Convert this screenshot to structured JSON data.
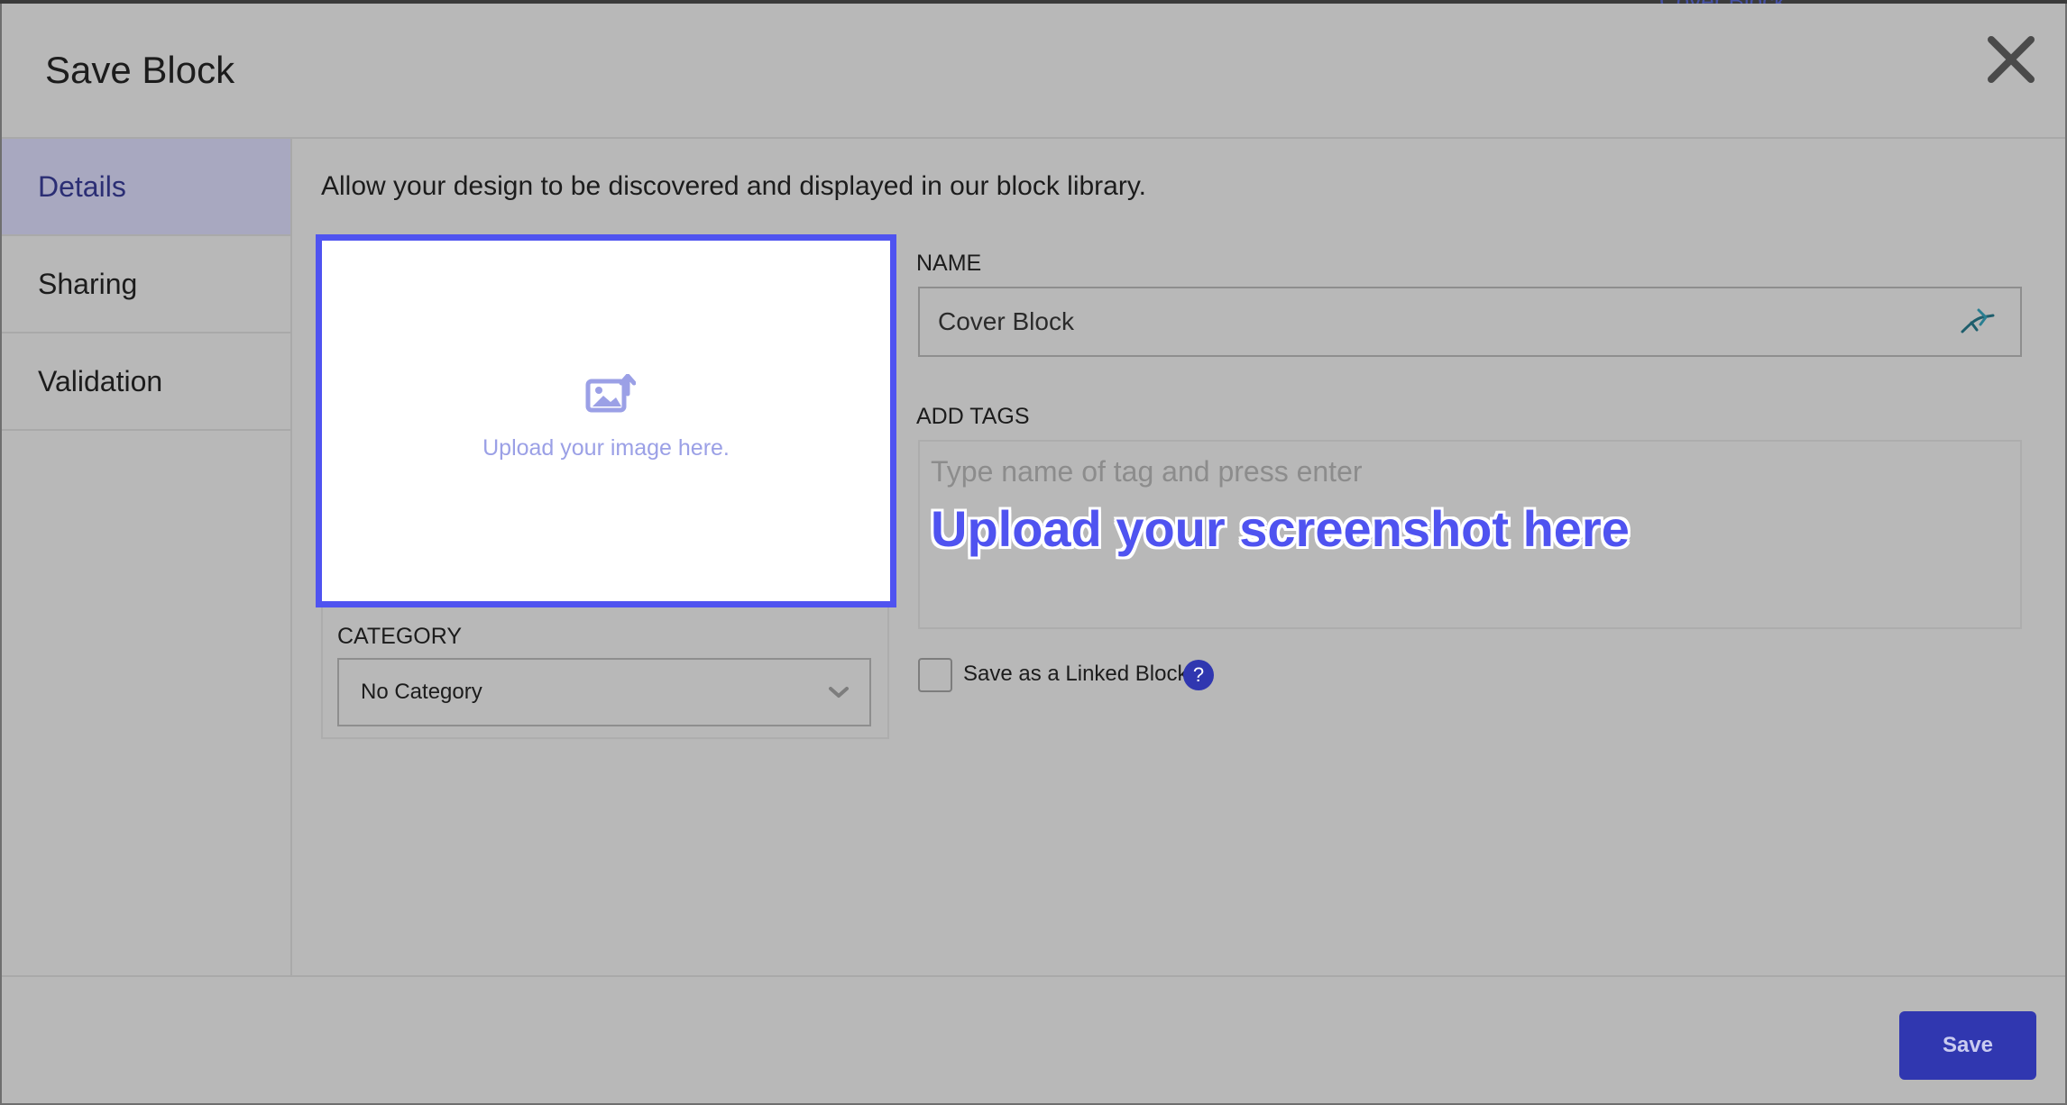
{
  "backdrop": {
    "link_text": "Cover Block"
  },
  "modal": {
    "title": "Save Block",
    "close_icon": "close-icon"
  },
  "sidebar": {
    "items": [
      {
        "label": "Details",
        "active": true
      },
      {
        "label": "Sharing",
        "active": false
      },
      {
        "label": "Validation",
        "active": false
      }
    ]
  },
  "details": {
    "intro": "Allow your design to be discovered and displayed in our block library.",
    "upload": {
      "text": "Upload your image here.",
      "icon": "image-upload-icon"
    },
    "category": {
      "label": "CATEGORY",
      "selected": "No Category",
      "icon": "chevron-down-icon"
    },
    "name": {
      "label": "NAME",
      "value": "Cover Block",
      "icon": "extension-icon"
    },
    "tags": {
      "label": "ADD TAGS",
      "placeholder": "Type name of tag and press enter"
    },
    "overlay_caption": "Upload your screenshot here",
    "linked_block": {
      "label": "Save as a Linked Block",
      "checked": false,
      "help_glyph": "?"
    }
  },
  "footer": {
    "save_label": "Save"
  },
  "colors": {
    "accent": "#4f53f0",
    "primary_button": "#3037b0",
    "active_tab_text": "#2b2e74",
    "overlay_dim": "#b8b8b8"
  }
}
